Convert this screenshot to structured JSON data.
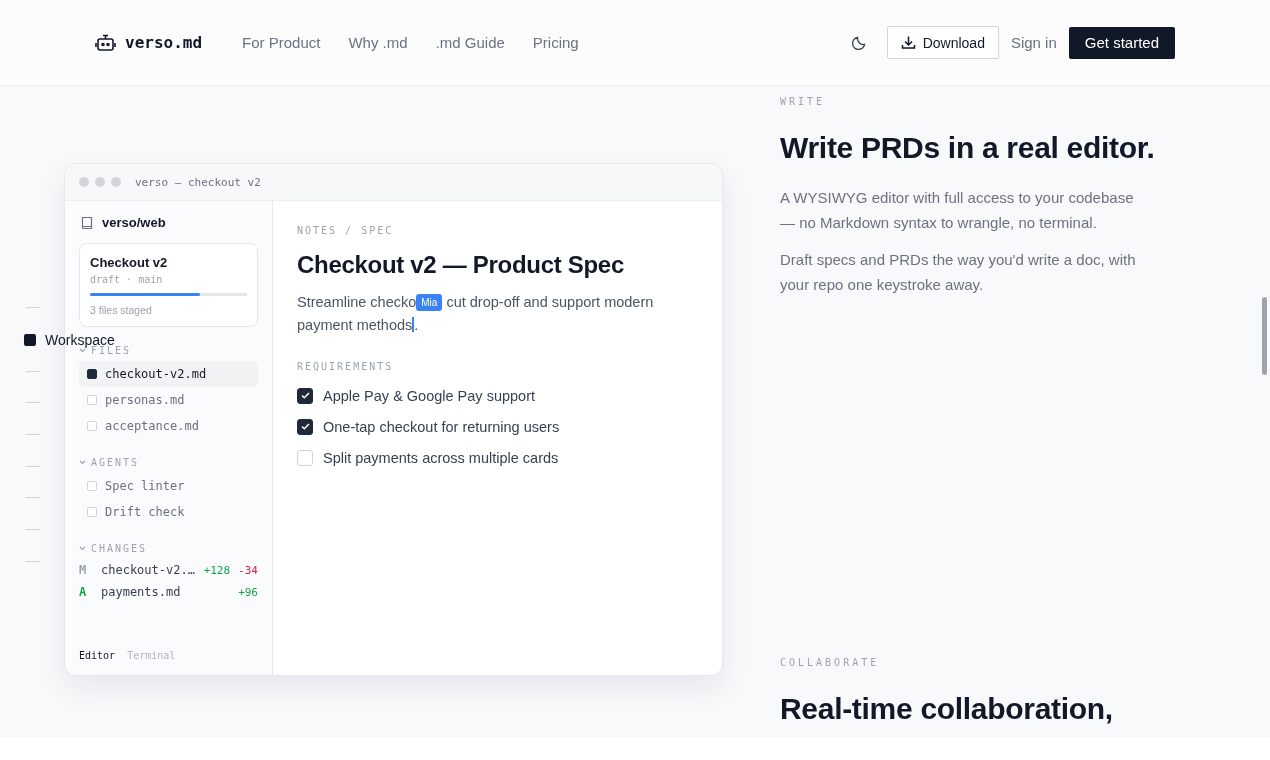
{
  "header": {
    "logo": "verso.md",
    "nav": [
      "For Product",
      "Why .md",
      ".md Guide",
      "Pricing"
    ],
    "download": "Download",
    "sign_in": "Sign in",
    "cta": "Get started"
  },
  "section_nav": [
    {
      "selected": false
    },
    {
      "label": "Workspace",
      "selected": true
    },
    {
      "selected": false
    },
    {
      "selected": false
    },
    {
      "selected": false
    },
    {
      "selected": false
    },
    {
      "selected": false
    },
    {
      "selected": false
    },
    {
      "selected": false
    }
  ],
  "window": {
    "title": "verso — checkout v2",
    "repo": "verso/web",
    "card": {
      "title": "Checkout v2",
      "meta": "draft · main",
      "level": 0.7,
      "note": "3 files staged"
    },
    "groups": [
      {
        "title": "FILES",
        "items": [
          {
            "name": "checkout-v2.md",
            "selected": true
          },
          {
            "name": "personas.md",
            "selected": false
          },
          {
            "name": "acceptance.md",
            "selected": false
          }
        ]
      },
      {
        "title": "AGENTS",
        "items": [
          {
            "name": "Spec linter",
            "selected": false
          },
          {
            "name": "Drift check",
            "selected": false
          }
        ]
      }
    ],
    "changes": {
      "title": "CHANGES",
      "items": [
        {
          "kind": "modified",
          "status": "M",
          "name": "checkout-v2.…",
          "added": "+128",
          "removed": "-34"
        },
        {
          "kind": "added",
          "status": "A",
          "name": "payments.md",
          "added": "+96"
        }
      ]
    },
    "tabs": [
      {
        "label": "Editor",
        "selected": true
      },
      {
        "label": "Terminal",
        "selected": false
      }
    ],
    "doc": {
      "breadcrumb": "NOTES / SPEC",
      "title": "Checkout v2 — Product Spec",
      "intro_start": "Streamline checko",
      "collaborator": "Mia",
      "intro_rest": "cut drop-off and support modern",
      "intro_rest_2": "payment methods",
      "intro_end": ".",
      "requirements_label": "REQUIREMENTS",
      "requirements": [
        {
          "text": "Apple Pay & Google Pay support",
          "checked": true
        },
        {
          "text": "One-tap checkout for returning users",
          "checked": true
        },
        {
          "text": "Split payments across multiple cards",
          "checked": false
        }
      ]
    }
  },
  "sections": [
    {
      "eyebrow": "WRITE",
      "heading": "Write PRDs in a real editor.",
      "paragraphs": [
        "A WYSIWYG editor with full access to your codebase — no Markdown syntax to wrangle, no terminal.",
        "Draft specs and PRDs the way you'd write a doc, with your repo one keystroke away."
      ]
    },
    {
      "eyebrow": "COLLABORATE",
      "heading": "Real-time collaboration,"
    }
  ]
}
